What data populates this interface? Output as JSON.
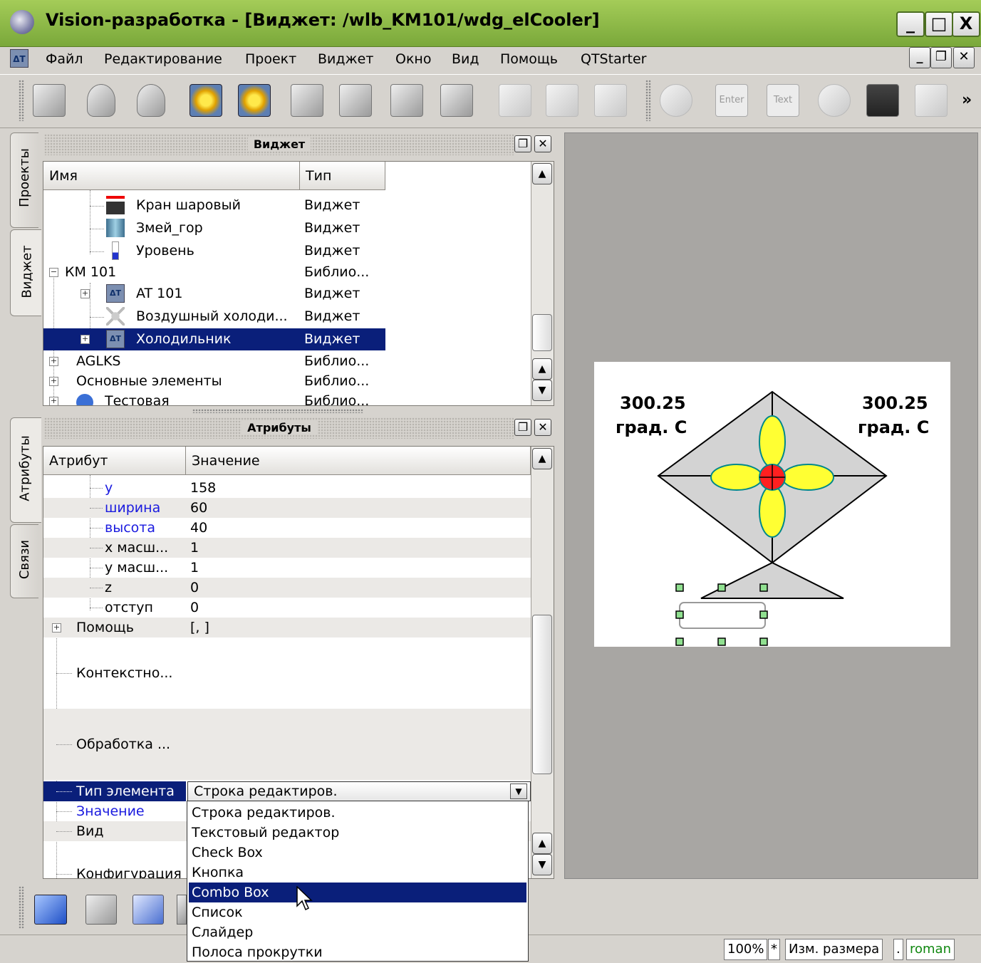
{
  "window": {
    "title": "Vision-разработка - [Виджет: /wlb_KM101/wdg_elCooler]",
    "min": "_",
    "max": "□",
    "close": "X"
  },
  "menu": {
    "items": [
      "Файл",
      "Редактирование",
      "Проект",
      "Виджет",
      "Окно",
      "Вид",
      "Помощь",
      "QTStarter"
    ],
    "app_icon_text": "ΔT"
  },
  "toolbar": {
    "enter_label": "Enter",
    "text_label": "Text",
    "more": "»"
  },
  "side_tabs": {
    "projects": "Проекты",
    "widget": "Виджет",
    "attributes": "Атрибуты",
    "links": "Связи"
  },
  "widget_dock": {
    "title": "Виджет",
    "columns": {
      "name": "Имя",
      "type": "Тип"
    },
    "rows": [
      {
        "name": "Кран шаровый",
        "type": "Виджет"
      },
      {
        "name": "Змей_гор",
        "type": "Виджет"
      },
      {
        "name": "Уровень",
        "type": "Виджет"
      },
      {
        "name": "КМ 101",
        "type": "Библио..."
      },
      {
        "name": "AT 101",
        "type": "Виджет"
      },
      {
        "name": "Воздушный холоди...",
        "type": "Виджет"
      },
      {
        "name": "Холодильник",
        "type": "Виджет"
      },
      {
        "name": "AGLKS",
        "type": "Библио..."
      },
      {
        "name": "Основные элементы",
        "type": "Библио..."
      },
      {
        "name": "Тестовая",
        "type": "Библио..."
      }
    ]
  },
  "attr_dock": {
    "title": "Атрибуты",
    "columns": {
      "attr": "Атрибут",
      "value": "Значение"
    },
    "rows": [
      {
        "name": "y",
        "value": "158"
      },
      {
        "name": "ширина",
        "value": "60"
      },
      {
        "name": "высота",
        "value": "40"
      },
      {
        "name": "x масш...",
        "value": "1"
      },
      {
        "name": "y масш...",
        "value": "1"
      },
      {
        "name": "z",
        "value": "0"
      },
      {
        "name": "отступ",
        "value": "0"
      },
      {
        "name": "Помощь",
        "value": "[, ]"
      },
      {
        "name": "Контекстно...",
        "value": ""
      },
      {
        "name": "Обработка ...",
        "value": ""
      },
      {
        "name": "Тип элемента",
        "value": "Строка редактиров."
      },
      {
        "name": "Значение",
        "value": ""
      },
      {
        "name": "Вид",
        "value": ""
      },
      {
        "name": "Конфигурация",
        "value": ""
      }
    ]
  },
  "dropdown": {
    "selected": "Combo Box",
    "options": [
      "Строка редактиров.",
      "Текстовый редактор",
      "Check Box",
      "Кнопка",
      "Combo Box",
      "Список",
      "Слайдер",
      "Полоса прокрутки"
    ]
  },
  "preview": {
    "left_value": "300.25",
    "left_unit": "град. С",
    "right_value": "300.25",
    "right_unit": "град. С"
  },
  "statusbar": {
    "zoom": "100%",
    "modified": "*",
    "mode": "Изм. размера",
    "sep": ".",
    "user": "roman"
  },
  "colors": {
    "title_green": "#8ebc45",
    "selection": "#0a1f7a",
    "fan_blade": "#ffff33",
    "fan_hub": "#ff2020",
    "cooler_fill": "#d3d3d3",
    "handle": "#90e090"
  }
}
